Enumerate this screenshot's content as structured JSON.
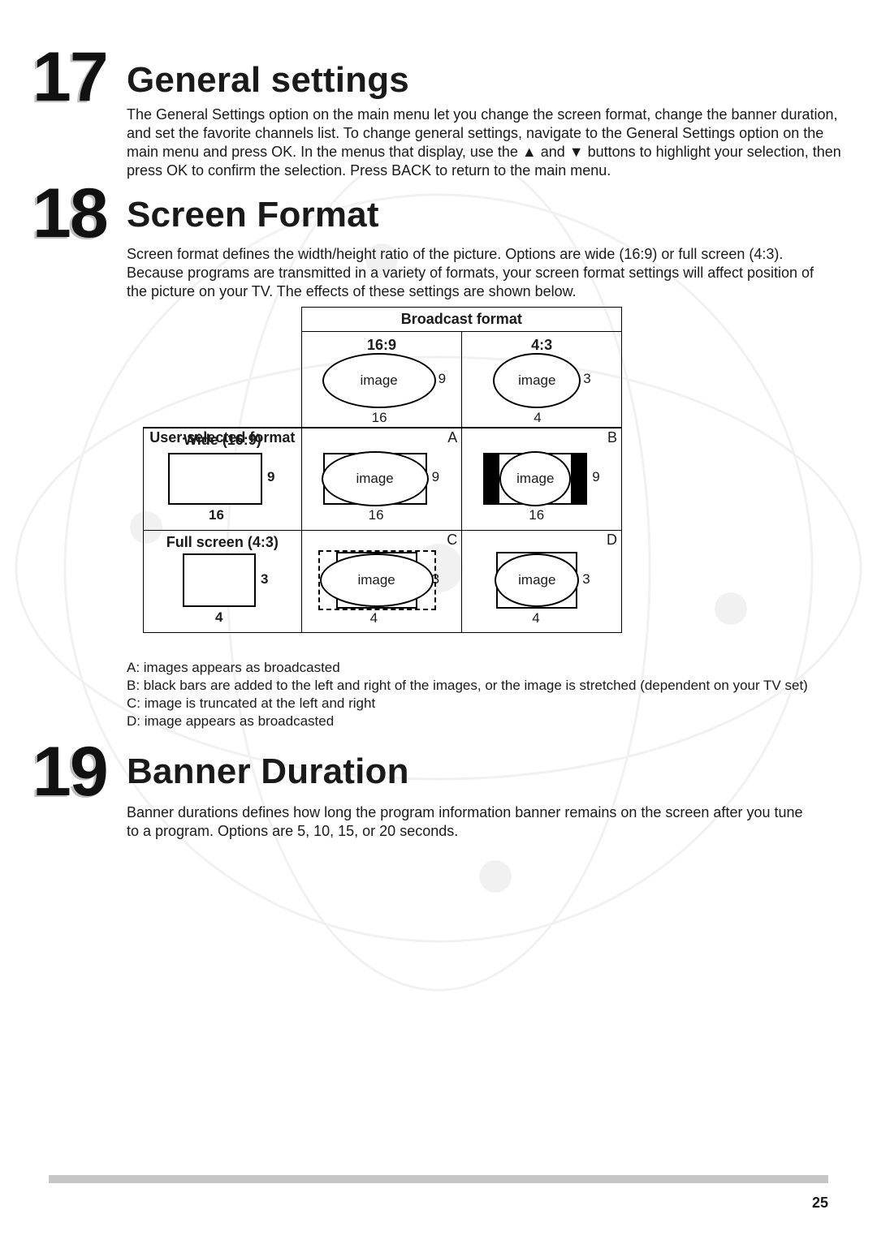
{
  "sections": [
    {
      "num": "17",
      "title": "General settings",
      "body": "The General Settings option on the main menu let you change the screen format, change the banner duration, and set the favorite channels list. To change general settings, navigate to the General Settings option on the main menu and press OK. In the menus that display, use the ▲ and ▼ buttons to highlight your selection, then press OK to confirm the selection. Press BACK to return to the main menu."
    },
    {
      "num": "18",
      "title": "Screen Format",
      "body": "Screen format defines the width/height ratio of the picture. Options are wide (16:9) or full screen (4:3). Because programs are transmitted in a variety of formats, your screen format settings will affect position of the picture on your TV. The effects of these settings are shown below."
    },
    {
      "num": "19",
      "title": "Banner Duration",
      "body": "Banner durations defines how long the program information banner remains on the screen after you tune to a program. Options are 5, 10, 15, or 20 seconds."
    }
  ],
  "table": {
    "broadcastHeader": "Broadcast format",
    "userHeader": "User-selected format",
    "col169": "16:9",
    "col43": "4:3",
    "rowWide": "Wide (16:9)",
    "rowFull": "Full screen (4:3)",
    "imageLabel": "image",
    "dims": {
      "w16": "16",
      "h9": "9",
      "w4": "4",
      "h3": "3"
    },
    "corners": {
      "A": "A",
      "B": "B",
      "C": "C",
      "D": "D"
    }
  },
  "notes": [
    "A: images appears as broadcasted",
    "B: black bars are added to the left and right of the images, or the image is stretched (dependent on your TV set)",
    "C: image is truncated at the left and right",
    "D: image appears as broadcasted"
  ],
  "pageNumber": "25"
}
